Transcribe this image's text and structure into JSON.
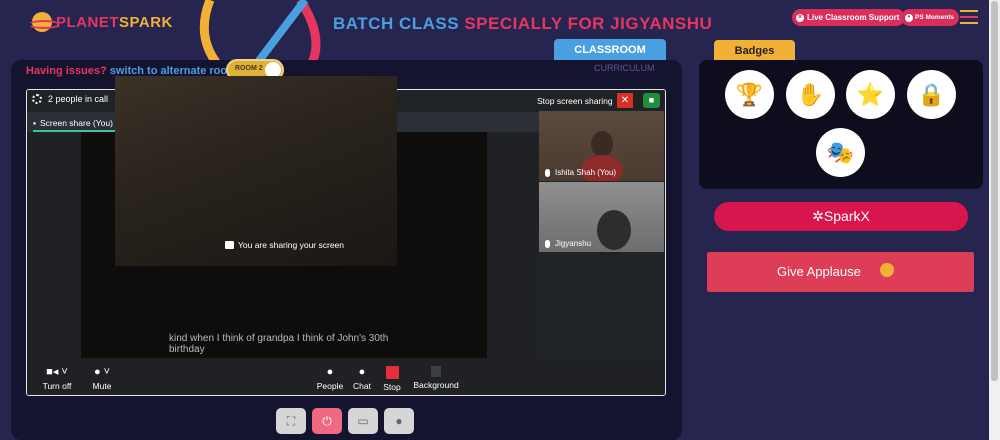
{
  "header": {
    "logo_text_a": "PLANET",
    "logo_text_b": "SPARK",
    "title_a": "BATCH CLASS",
    "title_b": "SPECIALLY FOR JIGYANSHU",
    "live_support": "Live Classroom Support",
    "ps_moments": "PS Moments"
  },
  "tabs": {
    "classroom": "CLASSROOM",
    "curriculum": "CURRICULUM",
    "badges": "Badges"
  },
  "issues": {
    "prefix": "Having issues?",
    "link": "switch to alternate room",
    "toggle_label": "ROOM 2"
  },
  "meet": {
    "people_count": "2 people in call",
    "stop_screen_sharing": "Stop screen sharing",
    "screen_share_tab": "Screen share (You)",
    "sharing_message": "You are sharing your screen",
    "subtitle": "kind when I think of grandpa I think of John's 30th birthday",
    "participants": [
      {
        "name": "Ishita Shah (You)"
      },
      {
        "name": "Jigyanshu"
      }
    ],
    "controls": {
      "camera": "Turn off",
      "mic": "Mute",
      "people": "People",
      "chat": "Chat",
      "stop": "Stop",
      "background": "Background"
    }
  },
  "right": {
    "sparkx": "SparkX",
    "give_applause": "Give Applause"
  },
  "colors": {
    "background": "#25254f",
    "accent_pink": "#e6365f",
    "accent_blue": "#4a9fe0",
    "accent_yellow": "#f2b136"
  }
}
